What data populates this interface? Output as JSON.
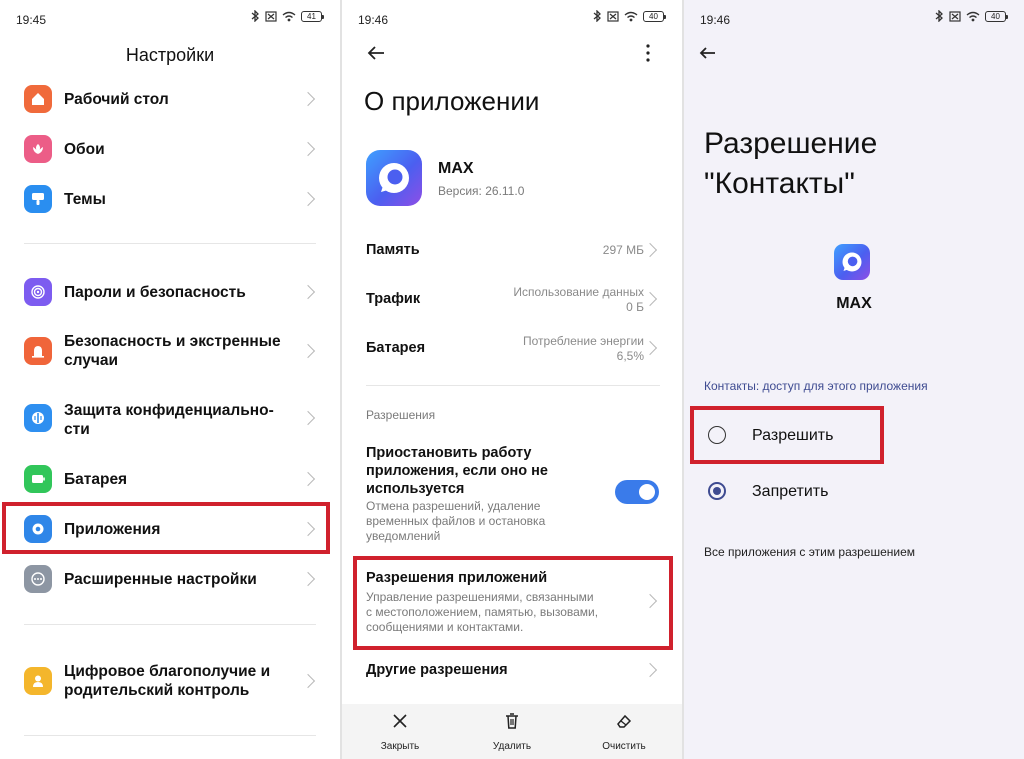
{
  "status": {
    "left": {
      "time": "19:45",
      "battery": "41"
    },
    "middle": {
      "time": "19:46",
      "battery": "40"
    },
    "right": {
      "time": "19:46",
      "battery": "40"
    }
  },
  "settings": {
    "title": "Настройки",
    "items": [
      {
        "label": "Рабочий стол",
        "icon": "home-icon",
        "color": "#f06a3b"
      },
      {
        "label": "Обои",
        "icon": "flower-icon",
        "color": "#ec5d87"
      },
      {
        "label": "Темы",
        "icon": "brush-icon",
        "color": "#2a8ef0"
      },
      {
        "label": "Пароли и безопасность",
        "icon": "fingerprint-icon",
        "color": "#7d5cf0"
      },
      {
        "label": "Безопасность и экстренные случаи",
        "icon": "alarm-icon",
        "color": "#f0653a"
      },
      {
        "label": "Защита конфиденциально-сти",
        "icon": "shield-icon",
        "color": "#2e8ff0"
      },
      {
        "label": "Батарея",
        "icon": "battery-icon",
        "color": "#31c65a"
      },
      {
        "label": "Приложения",
        "icon": "gear-icon",
        "color": "#2f86e8"
      },
      {
        "label": "Расширенные настройки",
        "icon": "dots-icon",
        "color": "#8d96a3"
      },
      {
        "label": "Цифровое благополучие и родительский контроль",
        "icon": "person-icon",
        "color": "#f4b62c"
      }
    ]
  },
  "app_info": {
    "title": "О приложении",
    "app_name": "MAX",
    "version": "Версия: 26.11.0",
    "memory": {
      "label": "Память",
      "value": "297 МБ"
    },
    "traffic": {
      "label": "Трафик",
      "value_line1": "Использование данных",
      "value_line2": "0 Б"
    },
    "battery": {
      "label": "Батарея",
      "value_line1": "Потребление энергии",
      "value_line2": "6,5%"
    },
    "permissions_section": "Разрешения",
    "pause": {
      "title_line1": "Приостановить работу",
      "title_line2": "приложения, если оно не",
      "title_line3": "используется",
      "desc_line1": "Отмена разрешений, удаление",
      "desc_line2": "временных файлов и остановка",
      "desc_line3": "уведомлений",
      "enabled": true
    },
    "app_permissions": {
      "title": "Разрешения приложений",
      "desc_line1": "Управление разрешениями, связанными",
      "desc_line2": "с местоположением, памятью, вызовами,",
      "desc_line3": "сообщениями и контактами."
    },
    "other_permissions": "Другие разрешения",
    "bottom": {
      "close": "Закрыть",
      "delete": "Удалить",
      "clear": "Очистить"
    }
  },
  "contacts_perm": {
    "title_line1": "Разрешение",
    "title_line2": "\"Контакты\"",
    "app_name": "MAX",
    "section": "Контакты: доступ для этого приложения",
    "allow": "Разрешить",
    "deny": "Запретить",
    "selected": "deny",
    "all_apps": "Все приложения с этим разрешением"
  },
  "colors": {
    "accent": "#3a7bea",
    "highlight": "#d0212d",
    "radio": "#3e4b91"
  }
}
